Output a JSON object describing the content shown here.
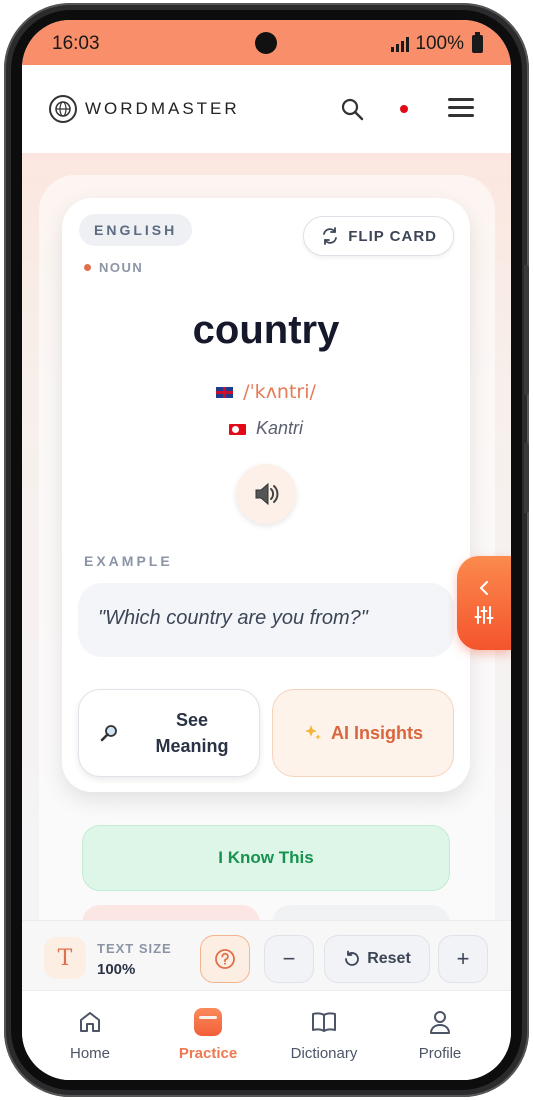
{
  "status_bar": {
    "time": "16:03",
    "battery": "100%"
  },
  "header": {
    "brand": "WORDMASTER"
  },
  "card": {
    "language": "ENGLISH",
    "flip_label": "FLIP CARD",
    "part_of_speech": "NOUN",
    "word": "country",
    "phonetic": "/ˈkʌntri/",
    "transliteration": "Kantri",
    "example_label": "EXAMPLE",
    "example": "\"Which country are you from?\"",
    "see_meaning_label": "See Meaning",
    "ai_insights_label": "AI Insights"
  },
  "actions": {
    "know_label": "I Know This"
  },
  "text_size": {
    "label": "TEXT SIZE",
    "value": "100%",
    "reset_label": "Reset",
    "minus": "−",
    "plus": "+"
  },
  "nav": [
    {
      "label": "Home",
      "icon": "home-icon"
    },
    {
      "label": "Practice",
      "icon": "practice-icon",
      "active": true
    },
    {
      "label": "Dictionary",
      "icon": "book-icon"
    },
    {
      "label": "Profile",
      "icon": "user-icon"
    }
  ],
  "colors": {
    "accent": "#f0774f",
    "status_bar": "#f98f6a",
    "success": "#17924f"
  }
}
